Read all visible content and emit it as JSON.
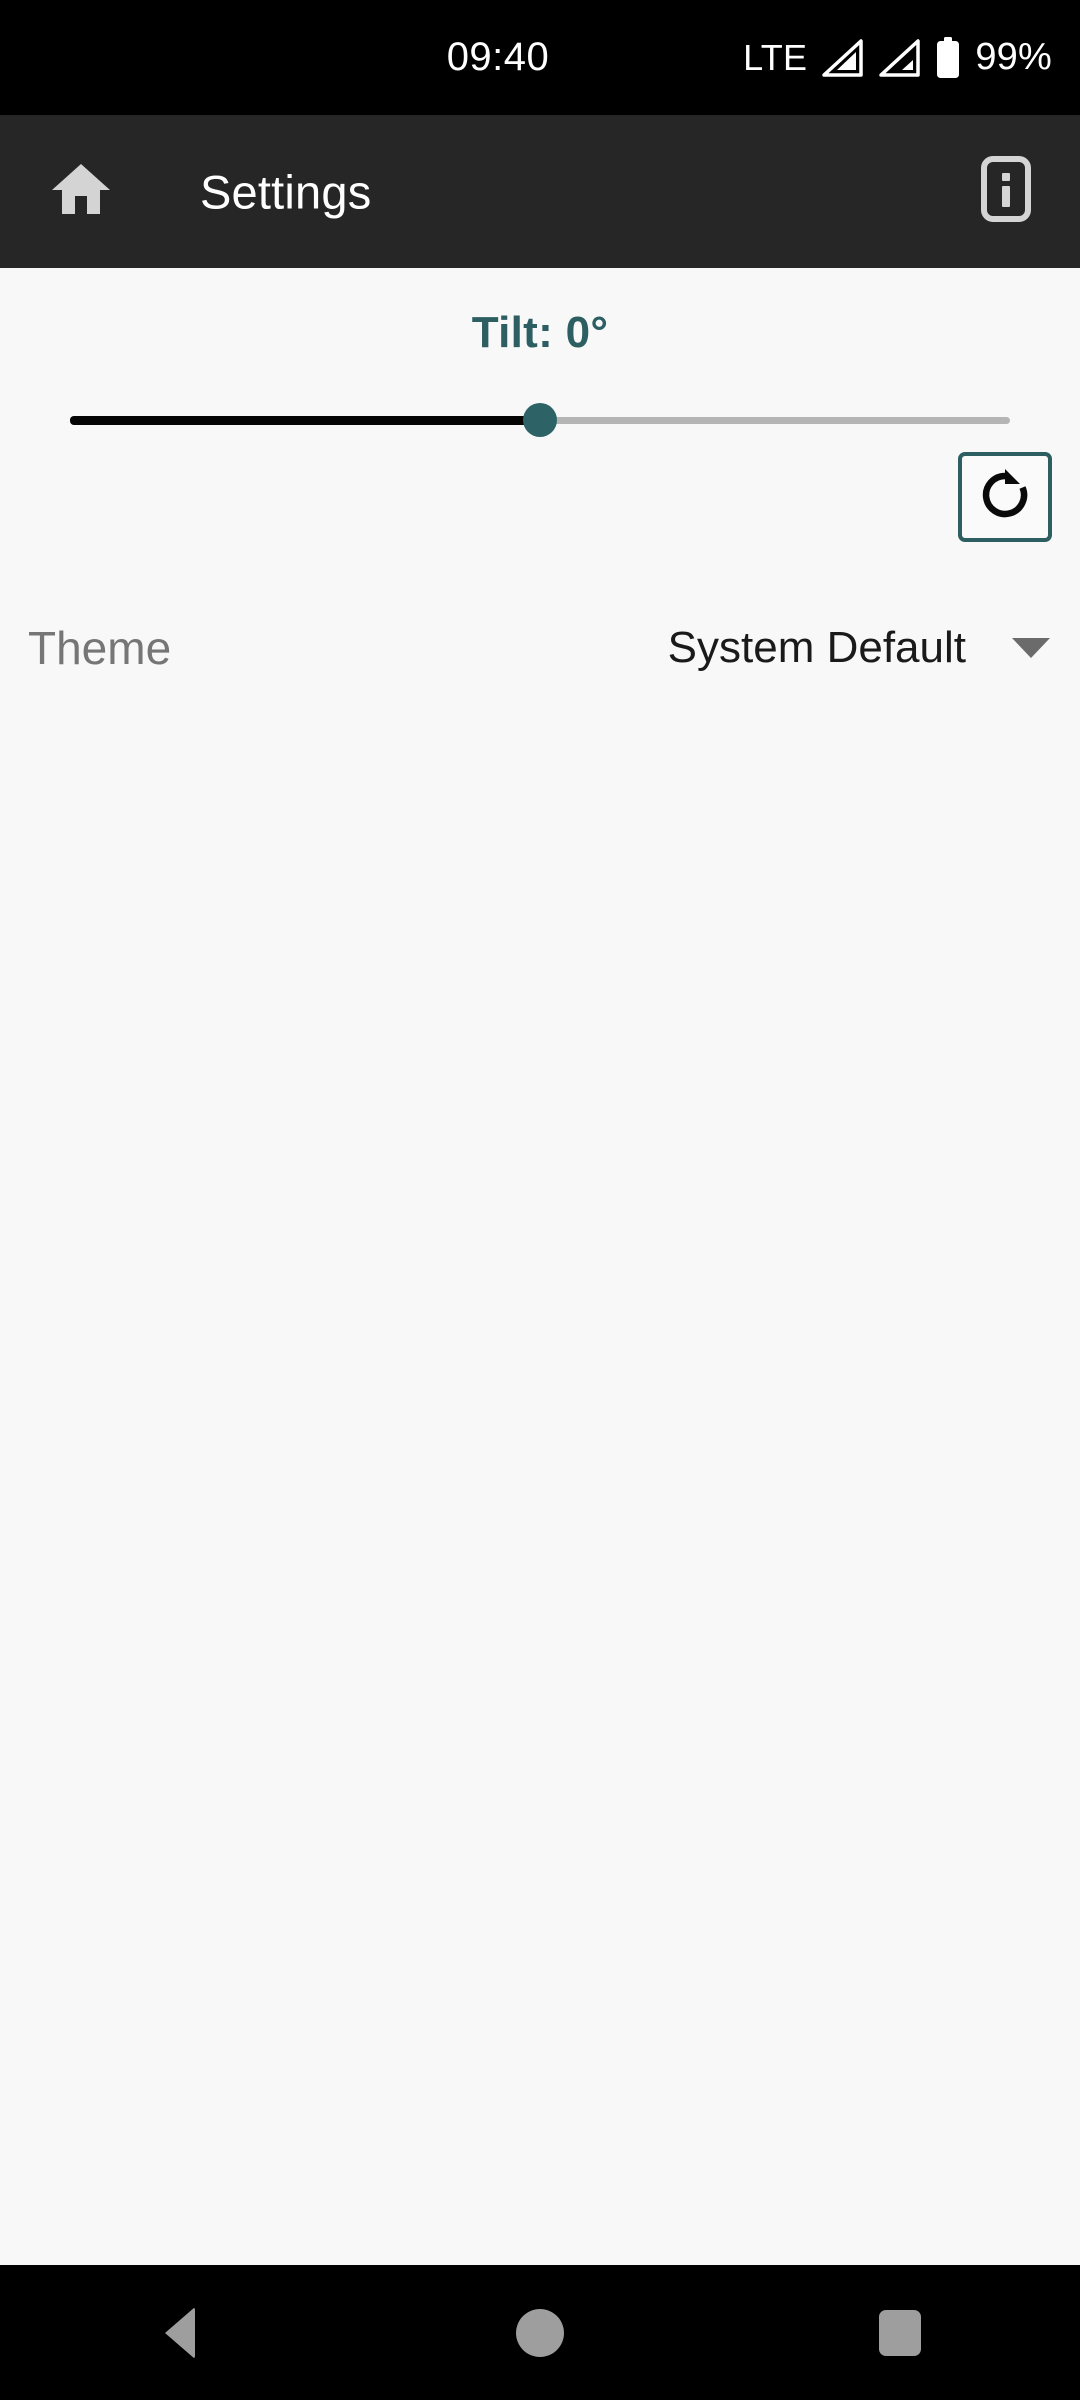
{
  "status_bar": {
    "time": "09:40",
    "network_label": "LTE",
    "battery_percent": "99%",
    "icons": {
      "signal_1": "signal-bar-icon",
      "signal_2": "signal-bar-icon",
      "battery": "battery-full-icon"
    },
    "background": "#000000",
    "foreground": "#ffffff"
  },
  "app_bar": {
    "title": "Settings",
    "home_icon": "home-icon",
    "info_icon": "info-badge-icon",
    "background": "#262626",
    "title_color": "#ffffff"
  },
  "content": {
    "tilt": {
      "label": "Tilt: 0°",
      "value": 0,
      "unit": "°",
      "color": "#2d5f62"
    },
    "slider": {
      "name": "tilt-slider",
      "value": 0,
      "position_percent": 50,
      "active_track_color": "#050505",
      "inactive_track_color": "#b5b5b5",
      "thumb_color": "#2d6366"
    },
    "reset_button": {
      "icon": "refresh-icon",
      "border_color": "#2d5f62"
    },
    "theme": {
      "label": "Theme",
      "value": "System Default",
      "caret_icon": "chevron-down-icon",
      "label_color": "#767676",
      "value_color": "#1a1a1a"
    },
    "background": "#f8f8f8"
  },
  "nav_bar": {
    "back_icon": "triangle-back-icon",
    "home_icon": "circle-home-icon",
    "recents_icon": "square-recents-icon",
    "background": "#000000",
    "icon_color": "#9e9e9e"
  }
}
